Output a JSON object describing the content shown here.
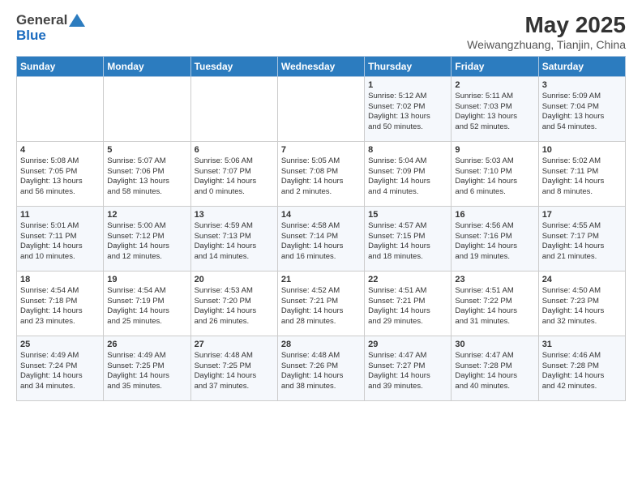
{
  "header": {
    "logo_general": "General",
    "logo_blue": "Blue",
    "title": "May 2025",
    "subtitle": "Weiwangzhuang, Tianjin, China"
  },
  "calendar": {
    "weekdays": [
      "Sunday",
      "Monday",
      "Tuesday",
      "Wednesday",
      "Thursday",
      "Friday",
      "Saturday"
    ],
    "weeks": [
      [
        {
          "day": "",
          "info": ""
        },
        {
          "day": "",
          "info": ""
        },
        {
          "day": "",
          "info": ""
        },
        {
          "day": "",
          "info": ""
        },
        {
          "day": "1",
          "info": "Sunrise: 5:12 AM\nSunset: 7:02 PM\nDaylight: 13 hours\nand 50 minutes."
        },
        {
          "day": "2",
          "info": "Sunrise: 5:11 AM\nSunset: 7:03 PM\nDaylight: 13 hours\nand 52 minutes."
        },
        {
          "day": "3",
          "info": "Sunrise: 5:09 AM\nSunset: 7:04 PM\nDaylight: 13 hours\nand 54 minutes."
        }
      ],
      [
        {
          "day": "4",
          "info": "Sunrise: 5:08 AM\nSunset: 7:05 PM\nDaylight: 13 hours\nand 56 minutes."
        },
        {
          "day": "5",
          "info": "Sunrise: 5:07 AM\nSunset: 7:06 PM\nDaylight: 13 hours\nand 58 minutes."
        },
        {
          "day": "6",
          "info": "Sunrise: 5:06 AM\nSunset: 7:07 PM\nDaylight: 14 hours\nand 0 minutes."
        },
        {
          "day": "7",
          "info": "Sunrise: 5:05 AM\nSunset: 7:08 PM\nDaylight: 14 hours\nand 2 minutes."
        },
        {
          "day": "8",
          "info": "Sunrise: 5:04 AM\nSunset: 7:09 PM\nDaylight: 14 hours\nand 4 minutes."
        },
        {
          "day": "9",
          "info": "Sunrise: 5:03 AM\nSunset: 7:10 PM\nDaylight: 14 hours\nand 6 minutes."
        },
        {
          "day": "10",
          "info": "Sunrise: 5:02 AM\nSunset: 7:11 PM\nDaylight: 14 hours\nand 8 minutes."
        }
      ],
      [
        {
          "day": "11",
          "info": "Sunrise: 5:01 AM\nSunset: 7:11 PM\nDaylight: 14 hours\nand 10 minutes."
        },
        {
          "day": "12",
          "info": "Sunrise: 5:00 AM\nSunset: 7:12 PM\nDaylight: 14 hours\nand 12 minutes."
        },
        {
          "day": "13",
          "info": "Sunrise: 4:59 AM\nSunset: 7:13 PM\nDaylight: 14 hours\nand 14 minutes."
        },
        {
          "day": "14",
          "info": "Sunrise: 4:58 AM\nSunset: 7:14 PM\nDaylight: 14 hours\nand 16 minutes."
        },
        {
          "day": "15",
          "info": "Sunrise: 4:57 AM\nSunset: 7:15 PM\nDaylight: 14 hours\nand 18 minutes."
        },
        {
          "day": "16",
          "info": "Sunrise: 4:56 AM\nSunset: 7:16 PM\nDaylight: 14 hours\nand 19 minutes."
        },
        {
          "day": "17",
          "info": "Sunrise: 4:55 AM\nSunset: 7:17 PM\nDaylight: 14 hours\nand 21 minutes."
        }
      ],
      [
        {
          "day": "18",
          "info": "Sunrise: 4:54 AM\nSunset: 7:18 PM\nDaylight: 14 hours\nand 23 minutes."
        },
        {
          "day": "19",
          "info": "Sunrise: 4:54 AM\nSunset: 7:19 PM\nDaylight: 14 hours\nand 25 minutes."
        },
        {
          "day": "20",
          "info": "Sunrise: 4:53 AM\nSunset: 7:20 PM\nDaylight: 14 hours\nand 26 minutes."
        },
        {
          "day": "21",
          "info": "Sunrise: 4:52 AM\nSunset: 7:21 PM\nDaylight: 14 hours\nand 28 minutes."
        },
        {
          "day": "22",
          "info": "Sunrise: 4:51 AM\nSunset: 7:21 PM\nDaylight: 14 hours\nand 29 minutes."
        },
        {
          "day": "23",
          "info": "Sunrise: 4:51 AM\nSunset: 7:22 PM\nDaylight: 14 hours\nand 31 minutes."
        },
        {
          "day": "24",
          "info": "Sunrise: 4:50 AM\nSunset: 7:23 PM\nDaylight: 14 hours\nand 32 minutes."
        }
      ],
      [
        {
          "day": "25",
          "info": "Sunrise: 4:49 AM\nSunset: 7:24 PM\nDaylight: 14 hours\nand 34 minutes."
        },
        {
          "day": "26",
          "info": "Sunrise: 4:49 AM\nSunset: 7:25 PM\nDaylight: 14 hours\nand 35 minutes."
        },
        {
          "day": "27",
          "info": "Sunrise: 4:48 AM\nSunset: 7:25 PM\nDaylight: 14 hours\nand 37 minutes."
        },
        {
          "day": "28",
          "info": "Sunrise: 4:48 AM\nSunset: 7:26 PM\nDaylight: 14 hours\nand 38 minutes."
        },
        {
          "day": "29",
          "info": "Sunrise: 4:47 AM\nSunset: 7:27 PM\nDaylight: 14 hours\nand 39 minutes."
        },
        {
          "day": "30",
          "info": "Sunrise: 4:47 AM\nSunset: 7:28 PM\nDaylight: 14 hours\nand 40 minutes."
        },
        {
          "day": "31",
          "info": "Sunrise: 4:46 AM\nSunset: 7:28 PM\nDaylight: 14 hours\nand 42 minutes."
        }
      ]
    ]
  }
}
